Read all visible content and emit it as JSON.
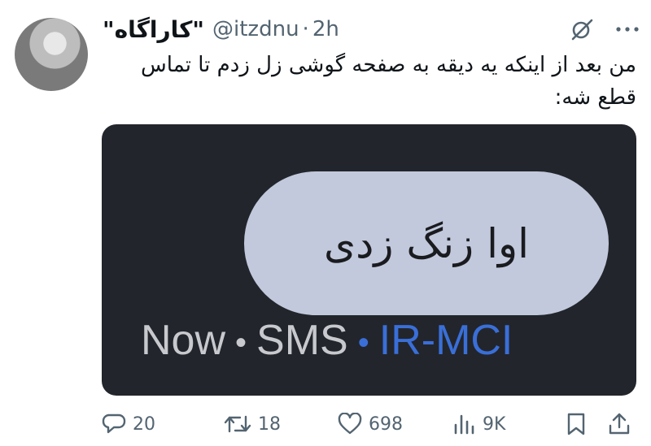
{
  "tweet": {
    "display_name": "\"کاراگاه\"",
    "handle": "@itzdnu",
    "separator": "·",
    "time": "2h",
    "text": "من بعد از اینکه یه دیقه به صفحه گوشی زل زدم تا تماس قطع شه:"
  },
  "media": {
    "bubble_text": "اوا زنگ زدی",
    "meta_time": "Now",
    "meta_sep": "•",
    "meta_type": "SMS",
    "meta_carrier": "IR-MCI"
  },
  "actions": {
    "replies": "20",
    "retweets": "18",
    "likes": "698",
    "views": "9K"
  },
  "colors": {
    "text": "#0f1419",
    "muted": "#536471",
    "media_bg": "#22252b",
    "bubble_bg": "#c2c9dc",
    "carrier": "#3a6fd8"
  }
}
